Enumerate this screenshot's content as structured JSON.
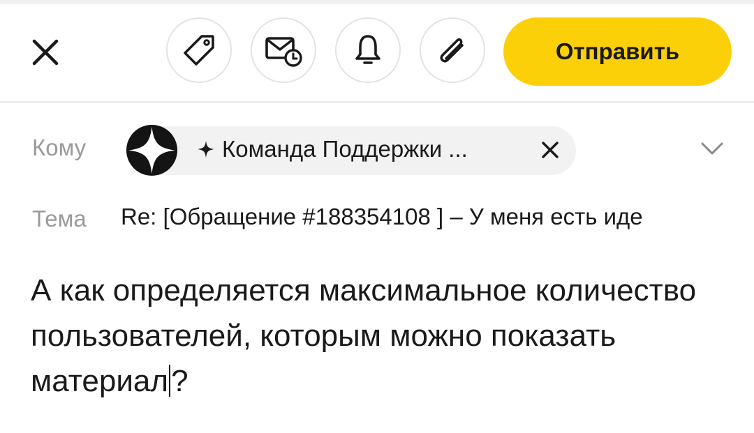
{
  "toolbar": {
    "close_icon": "close-icon",
    "tag_icon": "tag-icon",
    "scheduled_send_icon": "mail-clock-icon",
    "reminder_icon": "bell-icon",
    "attach_icon": "paperclip-icon",
    "send_label": "Отправить",
    "send_color": "#fcd009"
  },
  "recipients": {
    "label": "Кому",
    "chip": {
      "name": "Команда Поддержки ...",
      "avatar_icon": "sparkle-logo-icon",
      "prefix_icon": "sparkle-icon",
      "remove_icon": "close-icon"
    },
    "expand_icon": "chevron-down-icon"
  },
  "subject": {
    "label": "Тема",
    "value": "Re: [Обращение #188354108 ] – У меня есть иде"
  },
  "body": {
    "text_before_caret": "А как определяется максимальное количество пользователей, которым можно показать материал",
    "text_after_caret": "?"
  }
}
